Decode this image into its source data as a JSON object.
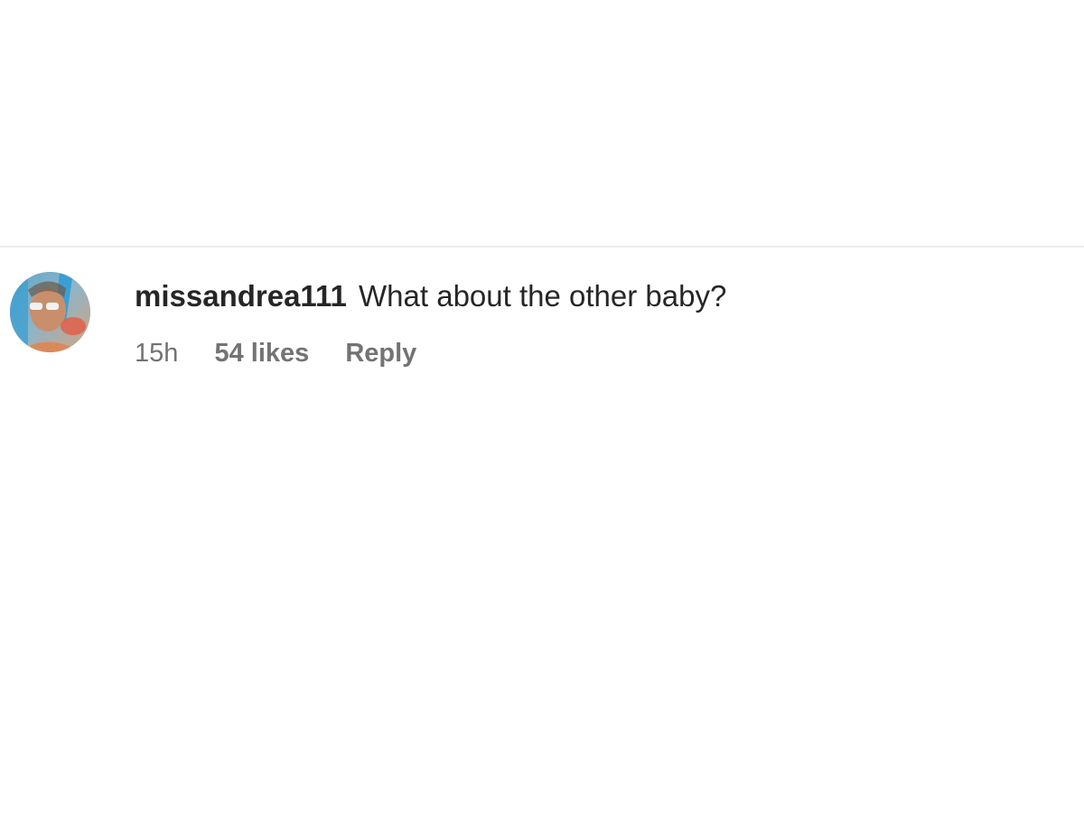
{
  "comment": {
    "username": "missandrea111",
    "text": "What about the other baby?",
    "timestamp": "15h",
    "likes": "54 likes",
    "reply_label": "Reply"
  },
  "colors": {
    "divider": "#ececec",
    "primary_text": "#262626",
    "secondary_text": "#737373"
  }
}
